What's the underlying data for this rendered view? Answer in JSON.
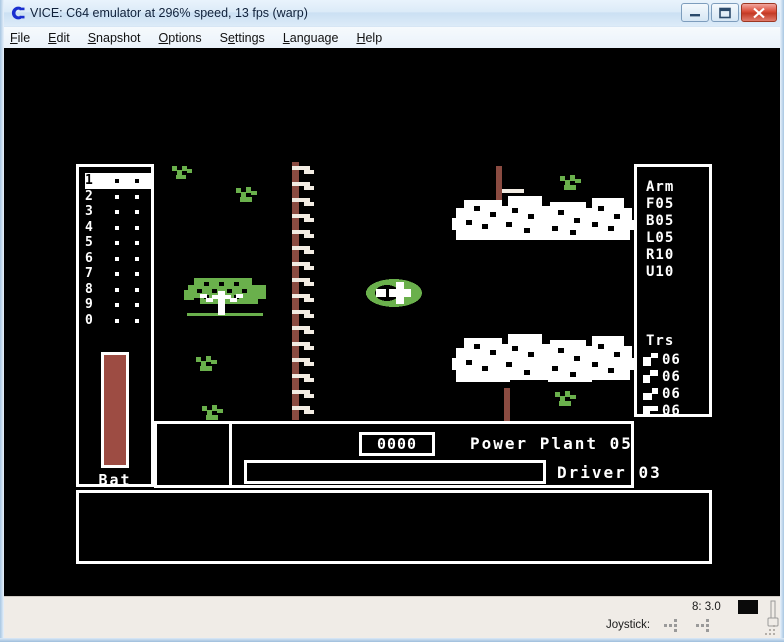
{
  "window": {
    "title": "VICE: C64 emulator at 296% speed, 13 fps (warp)",
    "icon": "commodore-c-icon",
    "buttons": {
      "minimize": "minimize-icon",
      "maximize": "maximize-icon",
      "close": "close-icon"
    }
  },
  "menubar": {
    "items": [
      {
        "label": "File",
        "accel": "F"
      },
      {
        "label": "Edit",
        "accel": "E"
      },
      {
        "label": "Snapshot",
        "accel": "S"
      },
      {
        "label": "Options",
        "accel": "O"
      },
      {
        "label": "Settings",
        "accel": "e"
      },
      {
        "label": "Language",
        "accel": "L"
      },
      {
        "label": "Help",
        "accel": "H"
      }
    ]
  },
  "game": {
    "left_panel": {
      "digits": [
        {
          "label": "1",
          "selected": true
        },
        {
          "label": "2",
          "selected": false
        },
        {
          "label": "3",
          "selected": false
        },
        {
          "label": "4",
          "selected": false
        },
        {
          "label": "5",
          "selected": false
        },
        {
          "label": "6",
          "selected": false
        },
        {
          "label": "7",
          "selected": false
        },
        {
          "label": "8",
          "selected": false
        },
        {
          "label": "9",
          "selected": false
        },
        {
          "label": "0",
          "selected": false
        }
      ],
      "battery_label": "Bat",
      "battery_percent": 100,
      "battery_color": "#9d4c43"
    },
    "right_panel": {
      "arm_rows": [
        "Arm",
        "F05",
        "B05",
        "L05",
        "R10",
        "U10"
      ],
      "trs_header": "Trs",
      "trs_rows": [
        {
          "glyph": "tool-glyph-1",
          "value": "06"
        },
        {
          "glyph": "tool-glyph-2",
          "value": "06"
        },
        {
          "glyph": "tool-glyph-3",
          "value": "06"
        },
        {
          "glyph": "tool-glyph-4",
          "value": "06"
        }
      ]
    },
    "status": {
      "score": "0000",
      "power_plant_label": "Power Plant",
      "power_plant_value": "05",
      "driver_label": "Driver",
      "driver_value": "03",
      "progress_percent": 0
    },
    "colors": {
      "background": "#000000",
      "foreground": "#ffffff",
      "green": "#6ab04c",
      "brown": "#8a4b41"
    }
  },
  "statusbar": {
    "joystick_label": "Joystick:",
    "drive_label": "8: 3.0",
    "drive_led": "drive-led-off"
  }
}
